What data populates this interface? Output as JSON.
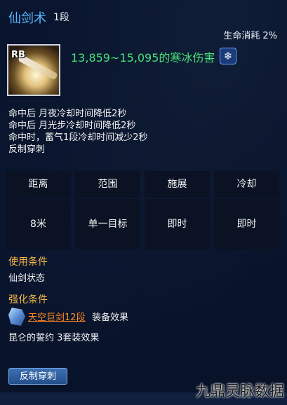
{
  "tooltip": {
    "skill_name": "仙剑术",
    "skill_level": "1段",
    "cost": "生命消耗 2%",
    "icon_label": "RB",
    "damage": "13,859~15,095的寒冰伤害",
    "effects": [
      "命中后 月夜冷却时间降低2秒",
      "命中后 月光步冷却时间降低2秒",
      "命中时，蓄气1段冷却时间减少2秒",
      "反制穿刺"
    ],
    "stats": [
      {
        "label": "距离",
        "value": "8米"
      },
      {
        "label": "范围",
        "value": "单一目标"
      },
      {
        "label": "施展",
        "value": "即时"
      },
      {
        "label": "冷却",
        "value": "即时"
      }
    ],
    "use_condition": {
      "title": "使用条件",
      "text": "仙剑状态"
    },
    "enhance": {
      "title": "强化条件",
      "gear_link": "天空巨剑12段",
      "gear_suffix": "装备效果",
      "set_text": "昆仑的誓约 3套装效果"
    },
    "tag_button": "反制穿刺"
  },
  "watermark": "九鼎灵脉数据",
  "colors": {
    "title": "#57b7ff",
    "damage": "#47e07a",
    "section_title": "#f5b64a",
    "link": "#ff8a1e"
  },
  "icons": [
    "skill-icon",
    "frost-icon",
    "gear-icon"
  ]
}
